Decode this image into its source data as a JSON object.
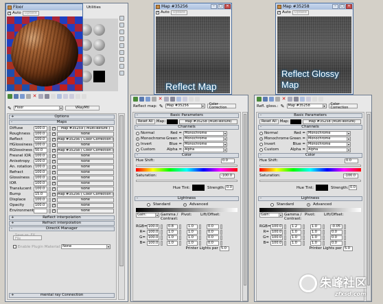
{
  "floor_window": {
    "title": "Floor",
    "auto_label": "Auto",
    "update_label": "Update",
    "utilities_tab": "Utilities"
  },
  "map1_window": {
    "title": "Map #35256",
    "auto_label": "Auto",
    "update_label": "Update",
    "overlay_label": "Reflect Map"
  },
  "map2_window": {
    "title": "Map #35258",
    "auto_label": "Auto",
    "update_label": "Update",
    "overlay_label": "Reflect Glossy Map"
  },
  "left_panel": {
    "material_name": "Floor",
    "material_type": "VRayMtl",
    "options_rollout": "Options",
    "maps_rollout": "Maps",
    "map_rows": [
      {
        "label": "Diffuse",
        "value": "100.0",
        "checked": true,
        "map": "Map #35259 ( MultiTexture )"
      },
      {
        "label": "Roughness",
        "value": "100.0",
        "checked": true,
        "map": "None"
      },
      {
        "label": "Reflect",
        "value": "100.0",
        "checked": true,
        "map": "Map #35256 ( Color Correction )"
      },
      {
        "label": "HGlossiness",
        "value": "100.0",
        "checked": true,
        "map": "None"
      },
      {
        "label": "RGlossiness",
        "value": "50.0",
        "checked": true,
        "map": "Map #35258 ( Color Correction )"
      },
      {
        "label": "Fresnel IOR",
        "value": "100.0",
        "checked": true,
        "map": "None"
      },
      {
        "label": "Anisotropy",
        "value": "100.0",
        "checked": true,
        "map": "None"
      },
      {
        "label": "An. rotation",
        "value": "100.0",
        "checked": true,
        "map": "None"
      },
      {
        "label": "Refract",
        "value": "100.0",
        "checked": true,
        "map": "None"
      },
      {
        "label": "Glossiness",
        "value": "100.0",
        "checked": true,
        "map": "None"
      },
      {
        "label": "IOR",
        "value": "100.0",
        "checked": true,
        "map": "None"
      },
      {
        "label": "Translucent",
        "value": "100.0",
        "checked": true,
        "map": "None"
      },
      {
        "label": "Bump",
        "value": "15.0",
        "checked": true,
        "map": "Map #35256 ( Color Correction )"
      },
      {
        "label": "Displace",
        "value": "100.0",
        "checked": true,
        "map": "None"
      },
      {
        "label": "Opacity",
        "value": "100.0",
        "checked": true,
        "map": "None"
      },
      {
        "label": "Environment",
        "value": "",
        "checked": true,
        "map": "None"
      }
    ],
    "reflect_interp": "Reflect interpolation",
    "refract_interp": "Refract interpolation",
    "directx": "DirectX Manager",
    "save_fx": "Save as .FX File",
    "enable_plugin": "Enable Plugin Material",
    "plugin_value": "None",
    "mental_ray": "mental ray Connection"
  },
  "cc_panels": [
    {
      "map_label": "Reflect map:",
      "map_name": "Map #35256",
      "type": "Color Correction",
      "basic": "Basic Parameters",
      "reset_all": "Reset All",
      "map_word": "Map:",
      "sub_map": "Map #35258 (MultiTexture)",
      "channels": "Channels",
      "normal": "Normal",
      "monochrome": "Monochrome",
      "invert": "Invert",
      "custom": "Custom",
      "red": "Red =",
      "green": "Green =",
      "blue": "Blue =",
      "alpha": "Alpha =",
      "red_v": "Monochrome",
      "green_v": "Monochrome",
      "blue_v": "Monochrome",
      "alpha_v": "Alpha",
      "color": "Color",
      "hue_shift": "Hue Shift:",
      "hue_shift_v": "0.0",
      "saturation": "Saturation:",
      "saturation_v": "-100.0",
      "hue_tint": "Hue Tint:",
      "strength": "Strength:",
      "strength_v": "0.0",
      "lightness": "Lightness",
      "standard": "Standard",
      "advanced": "Advanced",
      "gain": "Gain:",
      "gamma": "Gamma / Contrast:",
      "pivot": "Pivot:",
      "lift": "Lift/Offset:",
      "rgb_rows": [
        {
          "label": "RGB=",
          "gain": "100.0",
          "gamma": "0.8",
          "pivot": "1.0",
          "lift": "0.0"
        },
        {
          "label": "R=",
          "gain": "100.0",
          "gamma": "1.0",
          "pivot": "1.0",
          "lift": "0.0"
        },
        {
          "label": "G=",
          "gain": "100.0",
          "gamma": "1.0",
          "pivot": "1.0",
          "lift": "0.0"
        },
        {
          "label": "B=",
          "gain": "100.0",
          "gamma": "1.0",
          "pivot": "1.0",
          "lift": "0.0"
        }
      ],
      "printer": "Printer Lights per",
      "printer_v": "5.0"
    },
    {
      "map_label": "Refl. gloss.:",
      "map_name": "Map #35258",
      "type": "Color Correction",
      "basic": "Basic Parameters",
      "reset_all": "Reset All",
      "map_word": "Map:",
      "sub_map": "Map #35258 (MultiTexture)",
      "channels": "Channels",
      "normal": "Normal",
      "monochrome": "Monochrome",
      "invert": "Invert",
      "custom": "Custom",
      "red": "Red =",
      "green": "Green =",
      "blue": "Blue =",
      "alpha": "Alpha =",
      "red_v": "Monochrome",
      "green_v": "Monochrome",
      "blue_v": "Monochrome",
      "alpha_v": "Alpha",
      "color": "Color",
      "hue_shift": "Hue Shift:",
      "hue_shift_v": "0.0",
      "saturation": "Saturation:",
      "saturation_v": "-100.0",
      "hue_tint": "Hue Tint:",
      "strength": "Strength:",
      "strength_v": "0.0",
      "lightness": "Lightness",
      "standard": "Standard",
      "advanced": "Advanced",
      "gain": "Gain:",
      "gamma": "Gamma / Contrast:",
      "pivot": "Pivot:",
      "lift": "Lift/Offset:",
      "rgb_rows": [
        {
          "label": "RGB=",
          "gain": "100.0",
          "gamma": "1.2",
          "pivot": "1.0",
          "lift": "-0.05"
        },
        {
          "label": "R=",
          "gain": "100.0",
          "gamma": "1.0",
          "pivot": "1.0",
          "lift": "0.0"
        },
        {
          "label": "G=",
          "gain": "100.0",
          "gamma": "1.0",
          "pivot": "1.0",
          "lift": "0.0"
        },
        {
          "label": "B=",
          "gain": "100.0",
          "gamma": "1.0",
          "pivot": "1.0",
          "lift": "0.0"
        }
      ],
      "printer": "Printer Lights per",
      "printer_v": "5.0"
    }
  ],
  "watermark": {
    "text": "朱峰社区",
    "url": "zfxsd.com"
  },
  "colors": {
    "accent": "#1a6ea8",
    "titlebar": "#aabfdd"
  }
}
